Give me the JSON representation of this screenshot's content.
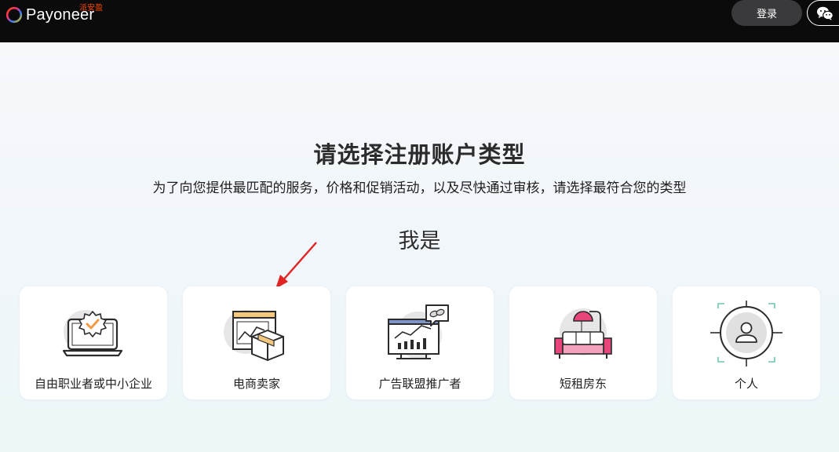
{
  "header": {
    "brand": "Payoneer",
    "brand_cn": "派安盈",
    "login_label": "登录"
  },
  "main": {
    "title": "请选择注册账户类型",
    "subtitle": "为了向您提供最匹配的服务，价格和促销活动，以及尽快通过审核，请选择最符合您的类型",
    "iam": "我是"
  },
  "account_types": [
    {
      "label": "自由职业者或中小企业",
      "icon": "laptop-badge-icon"
    },
    {
      "label": "电商卖家",
      "icon": "package-chart-icon"
    },
    {
      "label": "广告联盟推广者",
      "icon": "dashboard-chart-icon"
    },
    {
      "label": "短租房东",
      "icon": "sofa-lamp-icon"
    },
    {
      "label": "个人",
      "icon": "person-target-icon"
    }
  ],
  "colors": {
    "topbar": "#0b0b0c",
    "accent_orange": "#f39a43",
    "accent_pink": "#e8457a",
    "arrow_red": "#e02424"
  }
}
